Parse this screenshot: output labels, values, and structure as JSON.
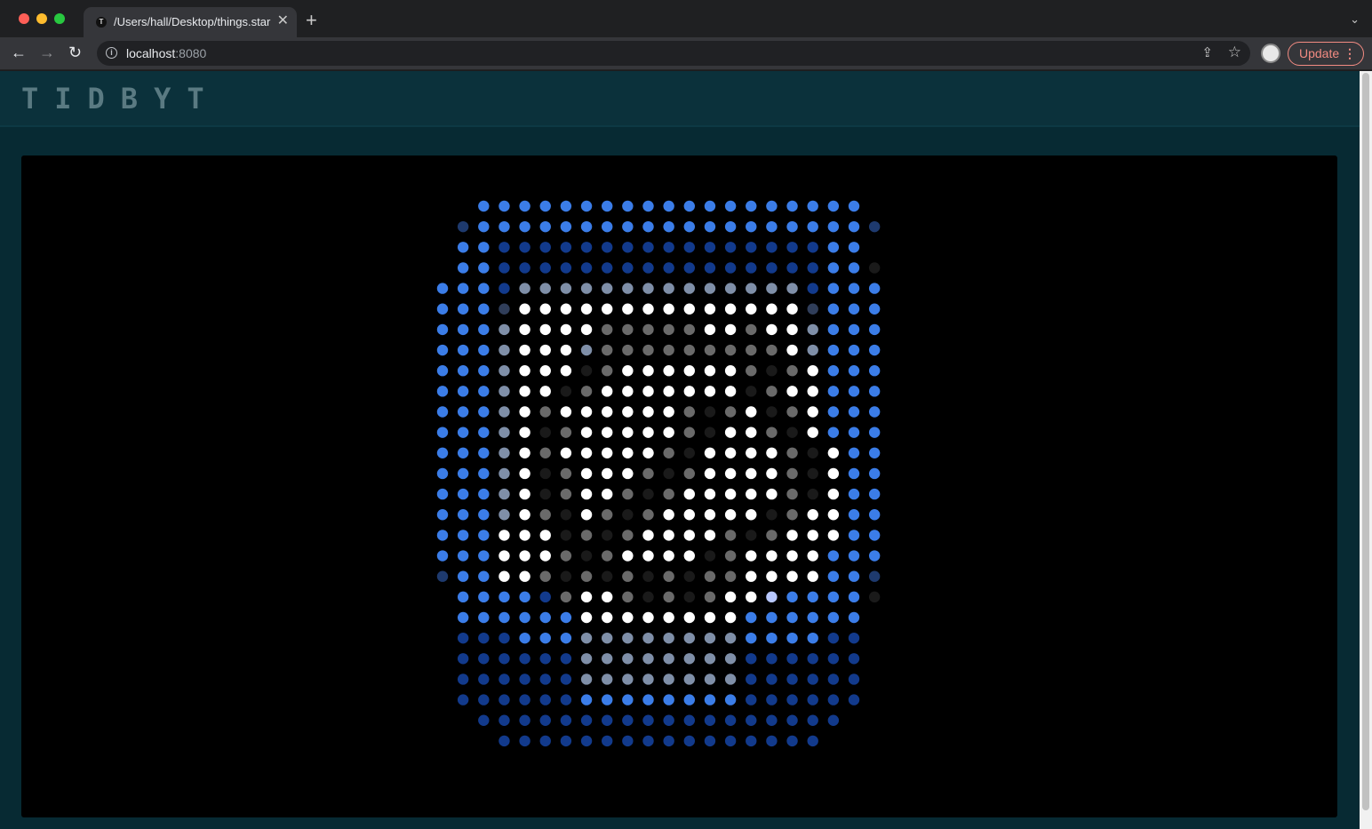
{
  "browser": {
    "tab_title": "/Users/hall/Desktop/things.star",
    "tab_favicon": "T",
    "tab_close_icon": "close-icon",
    "new_tab_icon": "plus-icon",
    "url_host": "localhost",
    "url_port": ":8080",
    "update_label": "Update",
    "back_icon": "arrow-left-icon",
    "forward_icon": "arrow-right-icon",
    "reload_icon": "reload-icon",
    "share_icon": "share-icon",
    "bookmark_icon": "star-icon"
  },
  "app": {
    "logo": "TIDBYT"
  },
  "colors": {
    "brand_bg": "#072a33",
    "header_bg": "#0b313b",
    "pixel_blue": "#3b7de8",
    "pixel_dark_blue": "#0f2d7a"
  },
  "display": {
    "description_icon": "things-app-icon",
    "grid": [
      "..BBBBBBBBBBBBBBBBBBB.",
      ".dBBBBBBBBBBBBBBBBBBBd",
      ".BBnnnnnnnnnnnnnnnnBB.",
      ".BBnnnnnnnnnnnnnnnnBBk",
      "BBBnggggggggggggggnBBB",
      "BBBmWWWWWWWWWWWWWWmBBB",
      "BBBgWWWWGGGGGWWGWWgBBB",
      "BBBgWWWgGGGGGGGGGWgBBB",
      "BBBgWWWkGWWWWWWGkGWBBB",
      "BBBgWWkGWWWWWWWkGWWBBB",
      "BBBgWGWWWWWWGkGWkGWBBB",
      "BBBgWkGWWWWWGkWWGkWBBB",
      "BBBgWGWWWWWGkWWWWGkWBB",
      "BBBgWkGWWWGkGWWWWGkWBB",
      "BBBgWkGWWGkGWWWWWGkWBB",
      "BBBgWGkWGkGWWWWWkGWWBB",
      "BBBWWWkGkGWWWWGkGWWWBB",
      "BBBWWWGkGWWWWkGWWWWBBB",
      "dBBWWGkGkGkGkGGWWWWBBd",
      ".BBBBnGWWGkGkGWWlBBBBk",
      ".BBBBBBWWWWWWWWBBBBBB.",
      ".nnnBBBggggggggBBBBnn.",
      ".nnnnnnggggggggnnnnnn.",
      ".nnnnnnggggggggnnnnnn.",
      ".nnnnnnBBBBBBBBnnnnnn.",
      "..nnnnnnnnnnnnnnnnnn..",
      "...nnnnnnnnnnnnnnnn..."
    ],
    "palette": {
      ".": "#000000",
      "B": "#3b7de8",
      "d": "#1e3a6e",
      "n": "#123a8c",
      "k": "#1a1a1a",
      "g": "#7f8fa8",
      "m": "#303e5a",
      "W": "#ffffff",
      "G": "#6a6a6a",
      "l": "#b8c8ff"
    }
  }
}
